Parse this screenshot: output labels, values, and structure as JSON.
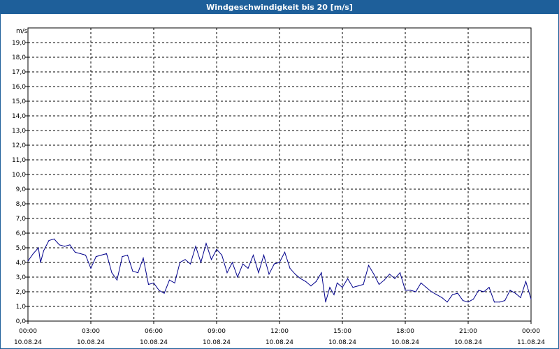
{
  "chart_data": {
    "type": "line",
    "title": "Windgeschwindigkeit bis 20 [m/s]",
    "ylabel": "m/s",
    "ylim": [
      0,
      20
    ],
    "xlim": [
      0,
      24
    ],
    "grid": true,
    "y_ticks": [
      "0,0",
      "1,0",
      "2,0",
      "3,0",
      "4,0",
      "5,0",
      "6,0",
      "7,0",
      "8,0",
      "9,0",
      "10,0",
      "11,0",
      "12,0",
      "13,0",
      "14,0",
      "15,0",
      "16,0",
      "17,0",
      "18,0",
      "19,0"
    ],
    "x_ticks": [
      {
        "time": "00:00",
        "date": "10.08.24"
      },
      {
        "time": "03:00",
        "date": "10.08.24"
      },
      {
        "time": "06:00",
        "date": "10.08.24"
      },
      {
        "time": "09:00",
        "date": "10.08.24"
      },
      {
        "time": "12:00",
        "date": "10.08.24"
      },
      {
        "time": "15:00",
        "date": "10.08.24"
      },
      {
        "time": "18:00",
        "date": "10.08.24"
      },
      {
        "time": "21:00",
        "date": "10.08.24"
      },
      {
        "time": "00:00",
        "date": "11.08.24"
      }
    ],
    "series": [
      {
        "color": "#00008b",
        "x": [
          0,
          0.25,
          0.5,
          0.6,
          0.75,
          1.0,
          1.25,
          1.5,
          1.75,
          2.0,
          2.25,
          2.5,
          2.75,
          3.0,
          3.25,
          3.5,
          3.75,
          4.0,
          4.25,
          4.5,
          4.75,
          5.0,
          5.25,
          5.5,
          5.75,
          6.0,
          6.25,
          6.5,
          6.75,
          7.0,
          7.25,
          7.5,
          7.75,
          8.0,
          8.25,
          8.5,
          8.75,
          9.0,
          9.25,
          9.5,
          9.75,
          10.0,
          10.25,
          10.5,
          10.75,
          11.0,
          11.25,
          11.5,
          11.75,
          12.0,
          12.25,
          12.5,
          12.75,
          13.0,
          13.25,
          13.5,
          13.75,
          14.0,
          14.2,
          14.4,
          14.6,
          14.75,
          15.0,
          15.25,
          15.5,
          15.75,
          16.0,
          16.25,
          16.5,
          16.75,
          17.0,
          17.25,
          17.5,
          17.75,
          18.0,
          18.25,
          18.5,
          18.75,
          19.0,
          19.25,
          19.5,
          19.75,
          20.0,
          20.25,
          20.5,
          20.75,
          21.0,
          21.25,
          21.5,
          21.75,
          22.0,
          22.25,
          22.5,
          22.75,
          23.0,
          23.25,
          23.5,
          23.75,
          24.0
        ],
        "y": [
          4.1,
          4.6,
          5.0,
          4.0,
          4.8,
          5.5,
          5.6,
          5.2,
          5.1,
          5.2,
          4.7,
          4.6,
          4.5,
          3.6,
          4.4,
          4.5,
          4.6,
          3.3,
          2.8,
          4.4,
          4.5,
          3.4,
          3.3,
          4.3,
          2.5,
          2.6,
          2.1,
          1.9,
          2.8,
          2.6,
          4.0,
          4.2,
          3.9,
          5.1,
          4.0,
          5.3,
          4.2,
          4.9,
          4.5,
          3.3,
          4.0,
          3.0,
          3.9,
          3.6,
          4.5,
          3.3,
          4.5,
          3.2,
          3.9,
          4.0,
          4.7,
          3.6,
          3.2,
          2.9,
          2.7,
          2.4,
          2.7,
          3.3,
          1.3,
          2.3,
          1.8,
          2.6,
          2.3,
          2.9,
          2.3,
          2.4,
          2.5,
          3.8,
          3.2,
          2.5,
          2.8,
          3.2,
          2.9,
          3.3,
          2.1,
          2.1,
          2.0,
          2.6,
          2.3,
          2.0,
          1.8,
          1.6,
          1.3,
          1.8,
          1.9,
          1.4,
          1.3,
          1.5,
          2.1,
          2.0,
          2.3,
          1.3,
          1.3,
          1.4,
          2.1,
          1.9,
          1.6,
          2.7,
          1.5
        ]
      }
    ]
  }
}
